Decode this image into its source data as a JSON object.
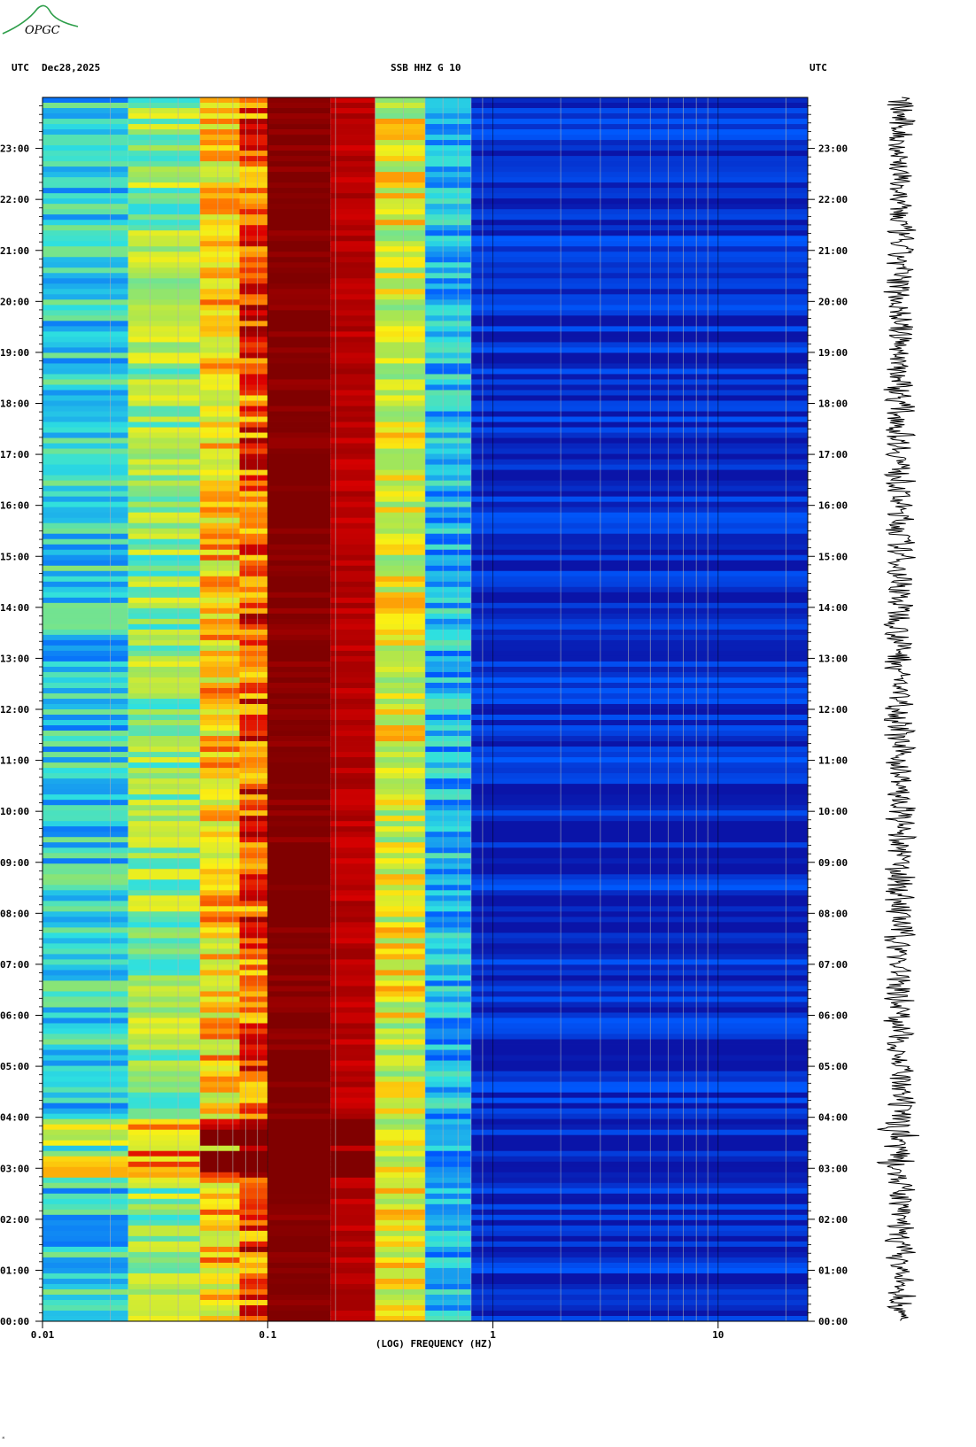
{
  "header": {
    "left_tz": "UTC",
    "date": "Dec28,2025",
    "station": "SSB HHZ G 10",
    "right_tz": "UTC"
  },
  "logo": {
    "text": "OPGC",
    "color": "#2e9e4a"
  },
  "footnote": "ᴹ",
  "chart_data": {
    "type": "heatmap",
    "title": "SSB HHZ G 10",
    "xlabel": "(LOG) FREQUENCY (HZ)",
    "x_scale": "log",
    "xlim": [
      0.01,
      25
    ],
    "x_ticks": [
      {
        "value": 0.01,
        "label": "0.01"
      },
      {
        "value": 0.1,
        "label": "0.1"
      },
      {
        "value": 1,
        "label": "1"
      },
      {
        "value": 10,
        "label": "10"
      }
    ],
    "ylim_hours": [
      0,
      24
    ],
    "y_ticks": [
      "00:00",
      "01:00",
      "02:00",
      "03:00",
      "04:00",
      "05:00",
      "06:00",
      "07:00",
      "08:00",
      "09:00",
      "10:00",
      "11:00",
      "12:00",
      "13:00",
      "14:00",
      "15:00",
      "16:00",
      "17:00",
      "18:00",
      "19:00",
      "20:00",
      "21:00",
      "22:00",
      "23:00"
    ],
    "frequency_bands": [
      {
        "fmin": 0.01,
        "fmax": 0.024,
        "level": 0.4
      },
      {
        "fmin": 0.024,
        "fmax": 0.05,
        "level": 0.55
      },
      {
        "fmin": 0.05,
        "fmax": 0.075,
        "level": 0.72
      },
      {
        "fmin": 0.075,
        "fmax": 0.1,
        "level": 0.85
      },
      {
        "fmin": 0.1,
        "fmax": 0.19,
        "level": 1.0
      },
      {
        "fmin": 0.19,
        "fmax": 0.3,
        "level": 0.95
      },
      {
        "fmin": 0.3,
        "fmax": 0.5,
        "level": 0.65
      },
      {
        "fmin": 0.5,
        "fmax": 0.8,
        "level": 0.35
      },
      {
        "fmin": 0.8,
        "fmax": 25,
        "level": 0.08
      }
    ],
    "events": [
      {
        "time_hours": 3.7,
        "label": "03:40"
      },
      {
        "time_hours": 3.1,
        "label": "03:05"
      }
    ],
    "colors": {
      "low": "#0a14a8",
      "mid": "#2ee0e0",
      "high": "#800000",
      "grid": "#b0b0b0"
    },
    "seismogram_color": "#000000"
  }
}
